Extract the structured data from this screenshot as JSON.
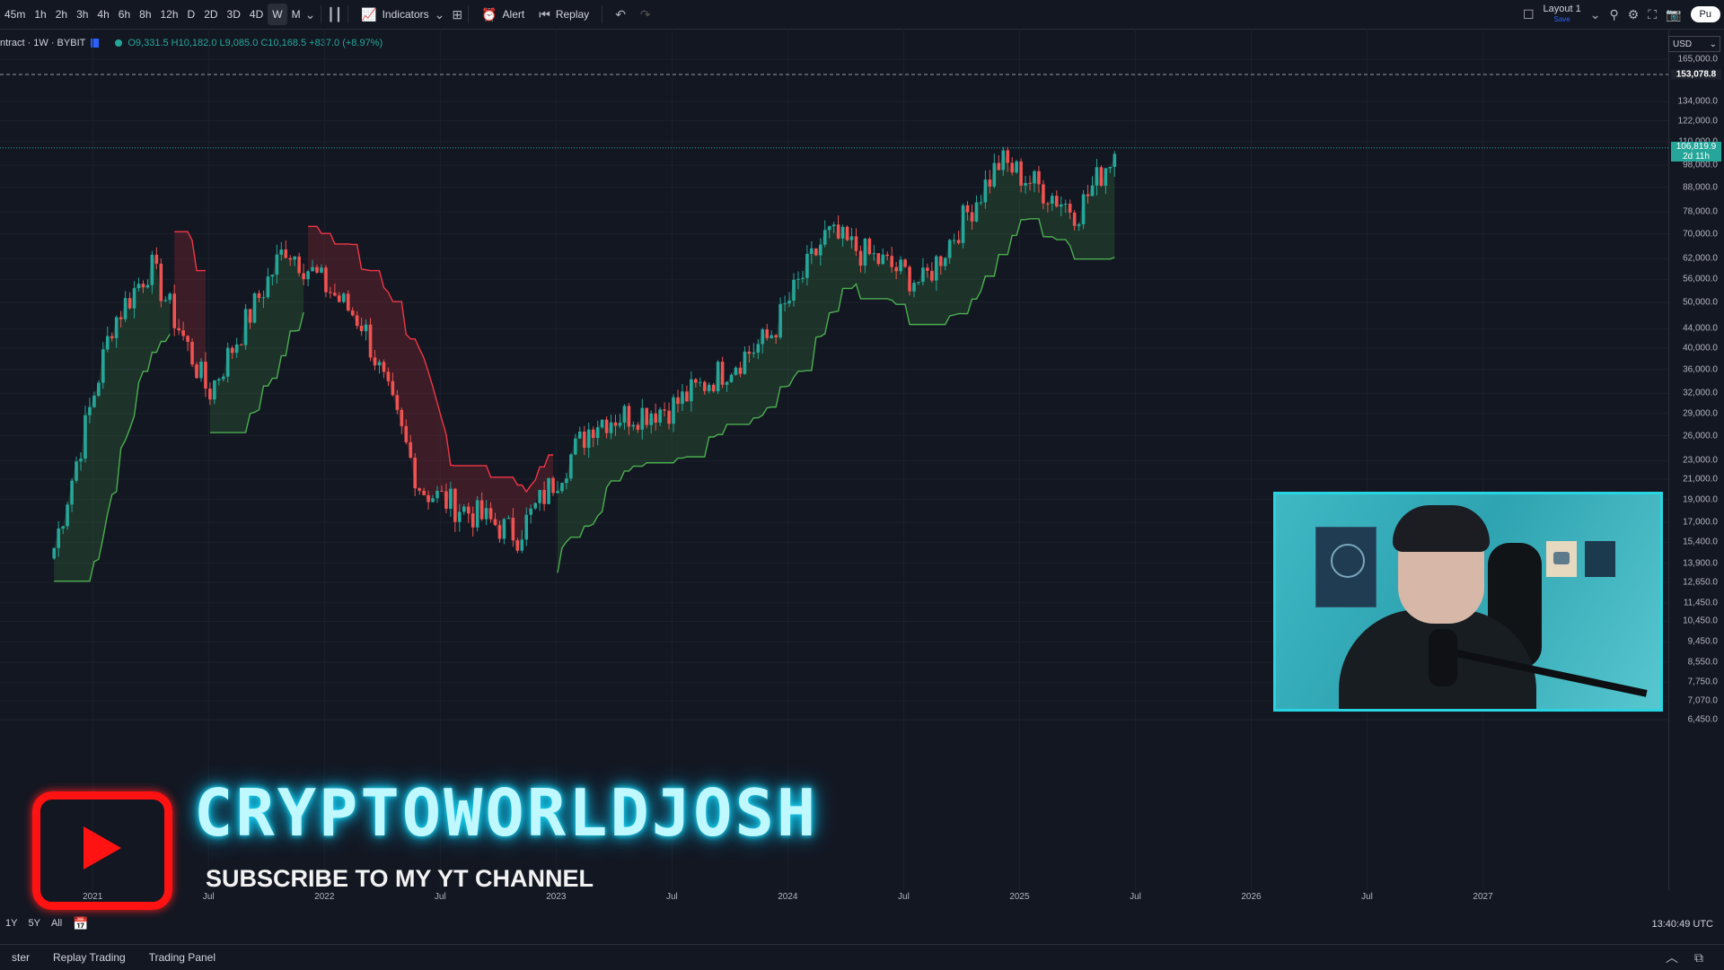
{
  "toolbar": {
    "timeframes": [
      "45m",
      "1h",
      "2h",
      "3h",
      "4h",
      "6h",
      "8h",
      "12h",
      "D",
      "2D",
      "3D",
      "4D",
      "W",
      "M"
    ],
    "active_timeframe": "W",
    "indicators_label": "Indicators",
    "alert_label": "Alert",
    "replay_label": "Replay",
    "layout_label": "Layout 1",
    "layout_save": "Save",
    "publish_label": "Pu"
  },
  "legend": {
    "symbol": "ntract · 1W · BYBIT",
    "values": "O9,331.5 H10,182.0 L9,085.0 C10,168.5 +837.0 (+8.97%)"
  },
  "price_axis": {
    "currency": "USD",
    "labels": [
      "165,000.0",
      "134,000.0",
      "122,000.0",
      "110,000.0",
      "98,000.0",
      "88,000.0",
      "78,000.0",
      "70,000.0",
      "62,000.0",
      "56,000.0",
      "50,000.0",
      "44,000.0",
      "40,000.0",
      "36,000.0",
      "32,000.0",
      "29,000.0",
      "26,000.0",
      "23,000.0",
      "21,000.0",
      "19,000.0",
      "17,000.0",
      "15,400.0",
      "13,900.0",
      "12,650.0",
      "11,450.0",
      "10,450.0",
      "9,450.0",
      "8,550.0",
      "7,750.0",
      "7,070.0",
      "6,450.0"
    ],
    "target_tag": "153,078.8",
    "last_price_tag": "106,819.9",
    "countdown": "2d 11h"
  },
  "time_axis": {
    "labels": [
      "2021",
      "Jul",
      "2022",
      "Jul",
      "2023",
      "Jul",
      "2024",
      "Jul",
      "2025",
      "Jul",
      "2026",
      "Jul",
      "2027"
    ]
  },
  "range_bar": {
    "ranges": [
      "1Y",
      "5Y",
      "All"
    ],
    "clock": "13:40:49 UTC"
  },
  "bottom_panel": {
    "tabs": [
      "ster",
      "Replay Trading",
      "Trading Panel"
    ]
  },
  "overlay": {
    "brand": "CRYPTOWORLDJOSH",
    "subscribe": "SUBSCRIBE TO MY YT CHANNEL"
  },
  "chart_data": {
    "type": "candlestick",
    "symbol": "BYBIT",
    "interval": "1W",
    "scale": "log",
    "ylim": [
      6450,
      165000
    ],
    "series": [
      {
        "name": "price",
        "x": [
          "2020-11",
          "2021-02",
          "2021-04",
          "2021-07",
          "2021-11",
          "2022-03",
          "2022-06",
          "2022-11",
          "2023-03",
          "2023-07",
          "2023-12",
          "2024-03",
          "2024-08",
          "2024-12",
          "2025-04",
          "2025-06"
        ],
        "values": [
          15000,
          45000,
          60000,
          32000,
          66000,
          45000,
          20000,
          16000,
          28000,
          30000,
          42000,
          70000,
          55000,
          100000,
          78000,
          106819.9
        ]
      }
    ],
    "supertrend": {
      "bull_segments": [
        [
          "2020-10",
          "2021-05"
        ],
        [
          "2021-07",
          "2021-12"
        ],
        [
          "2023-01",
          "2025-06"
        ]
      ],
      "bear_segments": [
        [
          "2021-05",
          "2021-07"
        ],
        [
          "2021-12",
          "2023-01"
        ]
      ]
    },
    "horizontal_lines": [
      153078.8,
      106819.9
    ]
  }
}
